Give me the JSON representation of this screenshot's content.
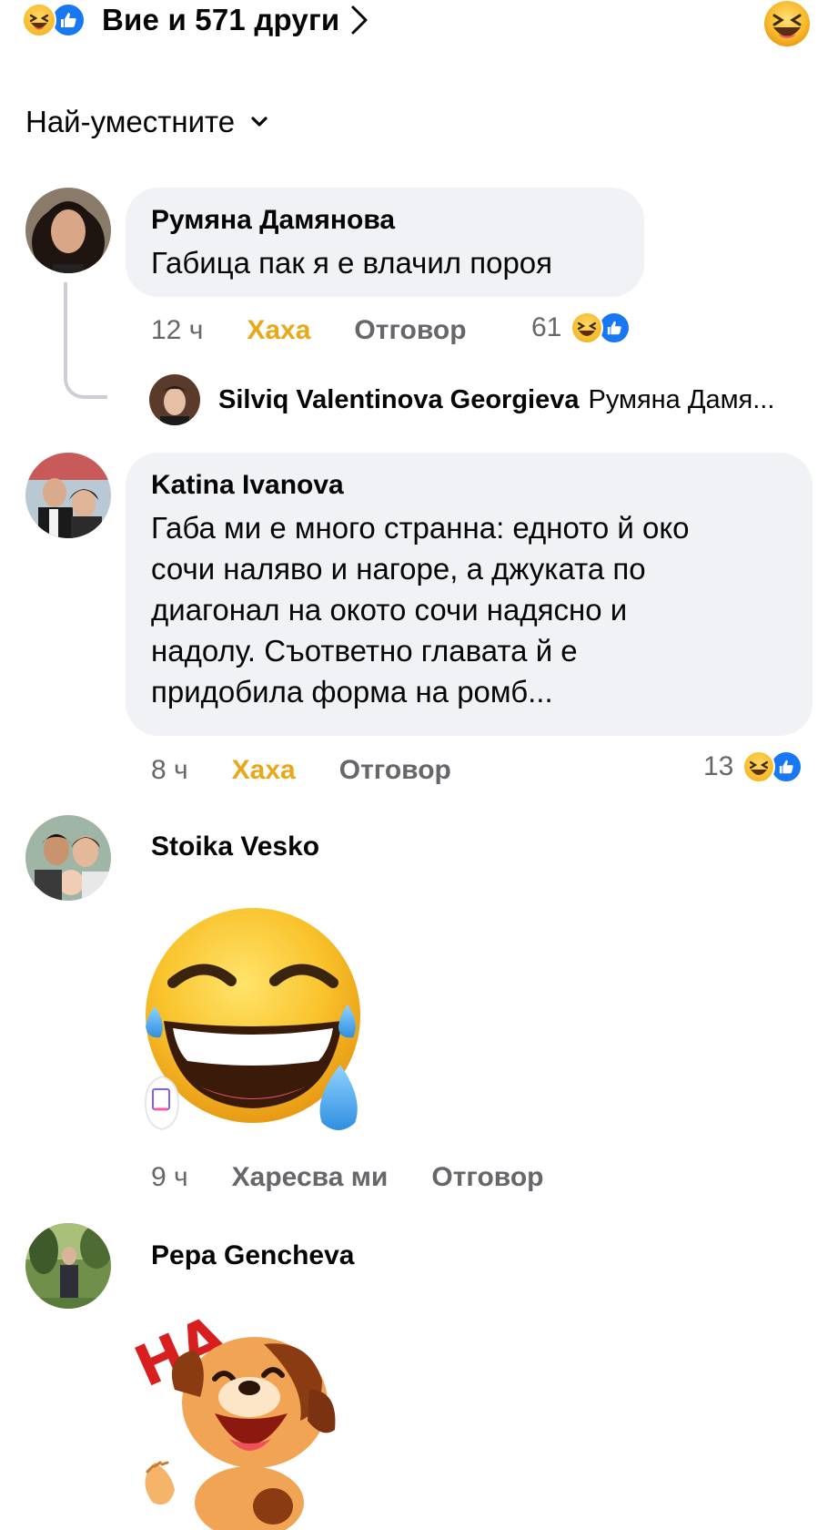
{
  "reactions_summary": {
    "text": "Вие и 571 други",
    "icons": [
      "haha-icon",
      "like-icon"
    ],
    "right_icon": "haha-icon"
  },
  "sort": {
    "label": "Най-уместните",
    "icon": "chevron-down-icon"
  },
  "comments": [
    {
      "author": "Румяна Дамянова",
      "text": "Габица пак я е влачил пороя",
      "time": "12 ч",
      "react_label": "Хаха",
      "reply_label": "Отговор",
      "reaction_count": "61",
      "reply_preview": {
        "author": "Silviq Valentinova Georgieva",
        "snippet": "Румяна Дамя..."
      }
    },
    {
      "author": "Katina Ivanova",
      "text_lines": [
        "Габа ми е много странна: едното й око",
        "сочи наляво и нагоре, а джуката по",
        "диагонал на окото сочи надясно и",
        "надолу. Съответно главата й е",
        "придобила форма на ромб..."
      ],
      "time": "8 ч",
      "react_label": "Хаха",
      "reply_label": "Отговор",
      "reaction_count": "13"
    },
    {
      "author": "Stoika Vesko",
      "sticker": "laughing-emoji-sticker",
      "time": "9 ч",
      "react_label": "Харесва ми",
      "reply_label": "Отговор"
    },
    {
      "author": "Pepa Gencheva",
      "sticker": "laughing-dog-sticker",
      "sticker_text": "HA"
    }
  ],
  "colors": {
    "bubble": "#f0f2f5",
    "haha_active": "#e9a817",
    "meta_gray": "#65676b",
    "like_blue": "#1877f2"
  }
}
